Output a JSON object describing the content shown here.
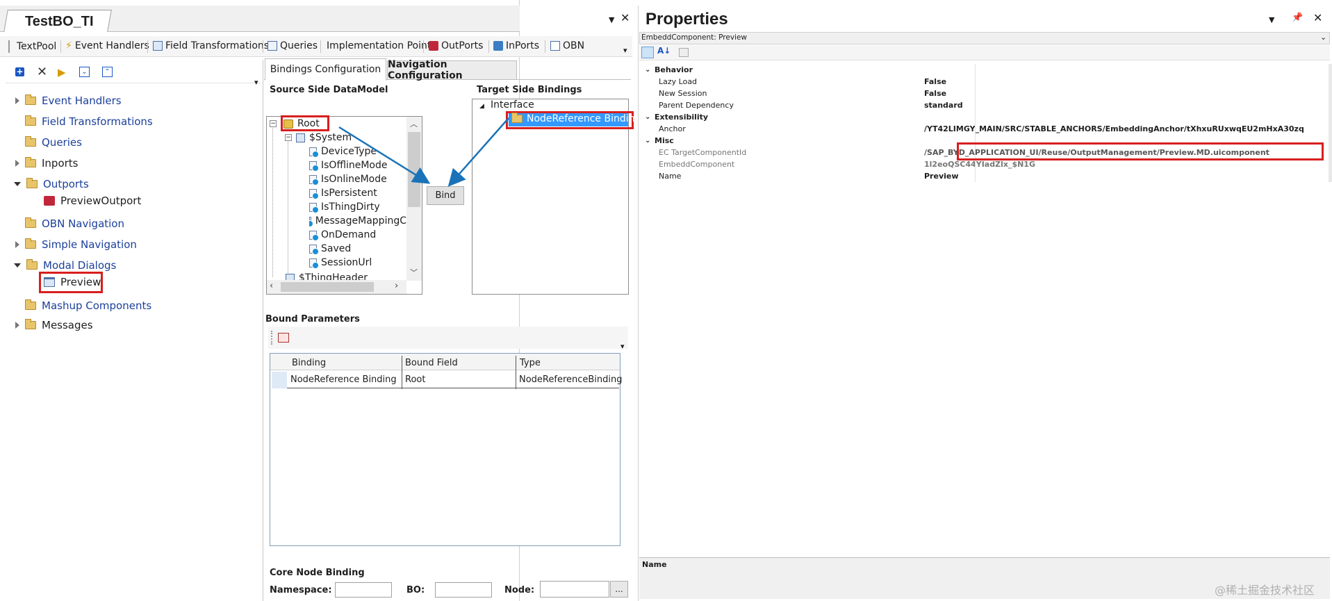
{
  "document_tab": {
    "title": "TestBO_TI"
  },
  "toolbar_top": {
    "items": [
      "TextPool",
      "Event Handlers",
      "Field Transformations",
      "Queries",
      "Implementation Points",
      "OutPorts",
      "InPorts",
      "OBN"
    ]
  },
  "tree": {
    "items": [
      {
        "label": "Event Handlers",
        "expander": "collapsed"
      },
      {
        "label": "Field Transformations",
        "expander": "none"
      },
      {
        "label": "Queries",
        "expander": "none"
      },
      {
        "label": "Inports",
        "expander": "collapsed"
      },
      {
        "label": "Outports",
        "expander": "expanded"
      },
      {
        "label": "PreviewOutport",
        "expander": "none"
      },
      {
        "label": "OBN Navigation",
        "expander": "none"
      },
      {
        "label": "Simple Navigation",
        "expander": "collapsed"
      },
      {
        "label": "Modal Dialogs",
        "expander": "expanded"
      },
      {
        "label": "Preview",
        "expander": "none"
      },
      {
        "label": "Mashup Components",
        "expander": "none"
      },
      {
        "label": "Messages",
        "expander": "collapsed"
      }
    ]
  },
  "bindings": {
    "tabs": [
      "Bindings Configuration",
      "Navigation Configuration"
    ],
    "source_title": "Source Side DataModel",
    "target_title": "Target Side Bindings",
    "source_tree": [
      "Root",
      "$System",
      "DeviceType",
      "IsOfflineMode",
      "IsOnlineMode",
      "IsPersistent",
      "IsThingDirty",
      "MessageMappingC",
      "OnDemand",
      "Saved",
      "SessionUrl",
      "$ThingHeader"
    ],
    "target_tree": [
      "Interface",
      "NodeReference Binding"
    ],
    "bind_button": "Bind",
    "bound_parameters_title": "Bound Parameters",
    "table": {
      "headers": [
        "Binding",
        "Bound Field",
        "Type"
      ],
      "rows": [
        [
          "NodeReference Binding",
          "Root",
          "NodeReferenceBinding"
        ]
      ]
    },
    "core_node": {
      "title": "Core Node Binding",
      "namespace_label": "Namespace:",
      "bo_label": "BO:",
      "node_label": "Node:",
      "browse": "..."
    }
  },
  "properties": {
    "title": "Properties",
    "object": "EmbeddComponent: Preview",
    "categories": [
      {
        "name": "Behavior",
        "rows": [
          [
            "Lazy Load",
            "False"
          ],
          [
            "New Session",
            "False"
          ],
          [
            "Parent Dependency",
            "standard"
          ]
        ]
      },
      {
        "name": "Extensibility",
        "rows": [
          [
            "Anchor",
            "/YT42LIMGY_MAIN/SRC/STABLE_ANCHORS/EmbeddingAnchor/tXhxuRUxwqEU2mHxA30zq"
          ]
        ]
      },
      {
        "name": "Misc",
        "rows": [
          [
            "EC TargetComponentId",
            "/SAP_BYD_APPLICATION_UI/Reuse/OutputManagement/Preview.MD.uicomponent"
          ],
          [
            "EmbeddComponent",
            "1l2eoQSC44YIadZlx_$N1G"
          ],
          [
            "Name",
            "Preview"
          ]
        ]
      }
    ],
    "description_title": "Name"
  },
  "watermark": "@稀土掘金技术社区",
  "colors": {
    "highlight": "#d81e1e",
    "arrow": "#1a73b8",
    "selection": "#3399ff"
  }
}
